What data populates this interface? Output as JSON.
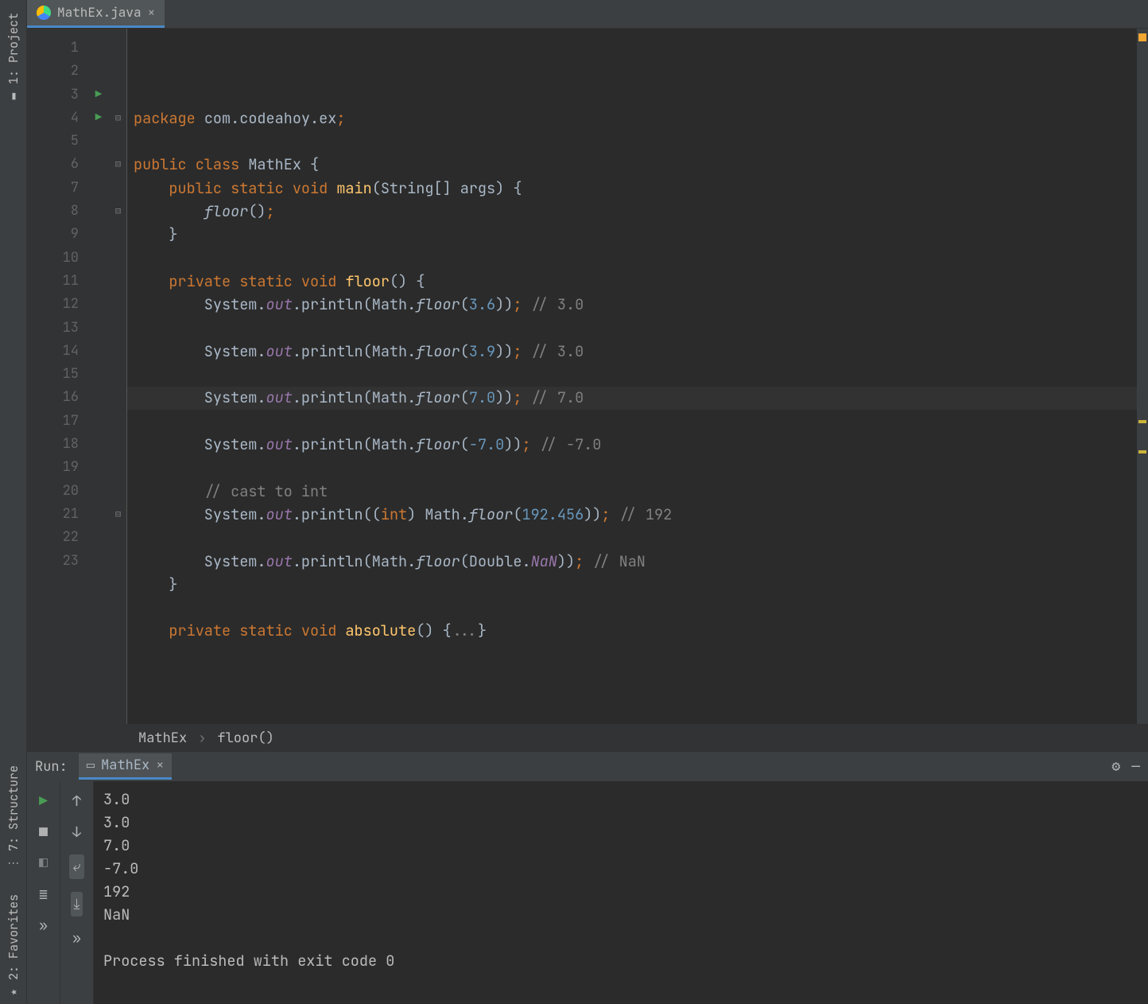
{
  "sidebar": {
    "project": "1: Project",
    "structure": "7: Structure",
    "favorites": "2: Favorites"
  },
  "tab": {
    "filename": "MathEx.java"
  },
  "breadcrumb": {
    "a": "MathEx",
    "b": "floor()"
  },
  "code": {
    "lines": [
      [
        [
          "kw",
          "package "
        ],
        [
          "ident",
          "com.codeahoy.ex"
        ],
        [
          "semi",
          ";"
        ]
      ],
      [],
      [
        [
          "kw",
          "public class "
        ],
        [
          "ident",
          "MathEx "
        ],
        [
          "ident",
          "{"
        ]
      ],
      [
        [
          "ident",
          "    "
        ],
        [
          "kw",
          "public static "
        ],
        [
          "kw",
          "void "
        ],
        [
          "fn",
          "main"
        ],
        [
          "ident",
          "(String[] args) {"
        ]
      ],
      [
        [
          "ident",
          "        "
        ],
        [
          "itf",
          "floor"
        ],
        [
          "ident",
          "()"
        ],
        [
          "semi",
          ";"
        ]
      ],
      [
        [
          "ident",
          "    }"
        ]
      ],
      [],
      [
        [
          "ident",
          "    "
        ],
        [
          "kw",
          "private static "
        ],
        [
          "kw",
          "void "
        ],
        [
          "fn",
          "floor"
        ],
        [
          "ident",
          "() {"
        ]
      ],
      [
        [
          "ident",
          "        System."
        ],
        [
          "it",
          "out"
        ],
        [
          "ident",
          ".println(Math."
        ],
        [
          "itf",
          "floor"
        ],
        [
          "ident",
          "("
        ],
        [
          "num",
          "3.6"
        ],
        [
          "ident",
          "))"
        ],
        [
          "semi",
          ";"
        ],
        [
          "cmt",
          " // 3.0"
        ]
      ],
      [],
      [
        [
          "ident",
          "        System."
        ],
        [
          "it",
          "out"
        ],
        [
          "ident",
          ".println(Math."
        ],
        [
          "itf",
          "floor"
        ],
        [
          "ident",
          "("
        ],
        [
          "num",
          "3.9"
        ],
        [
          "ident",
          "))"
        ],
        [
          "semi",
          ";"
        ],
        [
          "cmt",
          " // 3.0"
        ]
      ],
      [],
      [
        [
          "ident",
          "        System."
        ],
        [
          "it",
          "out"
        ],
        [
          "ident",
          ".println(Math."
        ],
        [
          "itf",
          "floor"
        ],
        [
          "ident",
          "("
        ],
        [
          "num",
          "7.0"
        ],
        [
          "ident",
          "))"
        ],
        [
          "semi",
          ";"
        ],
        [
          "cmt",
          " // 7.0"
        ]
      ],
      [],
      [
        [
          "ident",
          "        System."
        ],
        [
          "it",
          "out"
        ],
        [
          "ident",
          ".println(Math."
        ],
        [
          "itf",
          "floor"
        ],
        [
          "ident",
          "("
        ],
        [
          "num",
          "-7.0"
        ],
        [
          "ident",
          "))"
        ],
        [
          "semi",
          ";"
        ],
        [
          "cmt",
          " // -7.0"
        ]
      ],
      [],
      [
        [
          "ident",
          "        "
        ],
        [
          "cmt",
          "// cast to int"
        ]
      ],
      [
        [
          "ident",
          "        System."
        ],
        [
          "it",
          "out"
        ],
        [
          "ident",
          ".println(("
        ],
        [
          "kw",
          "int"
        ],
        [
          "ident",
          ") Math."
        ],
        [
          "itf",
          "floor"
        ],
        [
          "ident",
          "("
        ],
        [
          "num",
          "192.456"
        ],
        [
          "ident",
          "))"
        ],
        [
          "semi",
          ";"
        ],
        [
          "cmt",
          " // 192"
        ]
      ],
      [],
      [
        [
          "ident",
          "        System."
        ],
        [
          "it",
          "out"
        ],
        [
          "ident",
          ".println(Math."
        ],
        [
          "itf",
          "floor"
        ],
        [
          "ident",
          "(Double."
        ],
        [
          "it",
          "NaN"
        ],
        [
          "ident",
          "))"
        ],
        [
          "semi",
          ";"
        ],
        [
          "cmt",
          " // NaN"
        ]
      ],
      [
        [
          "ident",
          "    }"
        ]
      ],
      [],
      [
        [
          "ident",
          "    "
        ],
        [
          "kw",
          "private static void "
        ],
        [
          "fn",
          "absolute"
        ],
        [
          "ident",
          "() {"
        ],
        [
          "cmt",
          "..."
        ],
        [
          "ident",
          "}"
        ]
      ]
    ],
    "runMarkers": [
      3,
      4
    ],
    "foldMarkers": {
      "4": "⊟",
      "6": "⊟",
      "8": "⊟",
      "21": "⊟"
    }
  },
  "run": {
    "label": "Run:",
    "tab": "MathEx",
    "output": "3.0\n3.0\n7.0\n-7.0\n192\nNaN\n\nProcess finished with exit code 0"
  }
}
